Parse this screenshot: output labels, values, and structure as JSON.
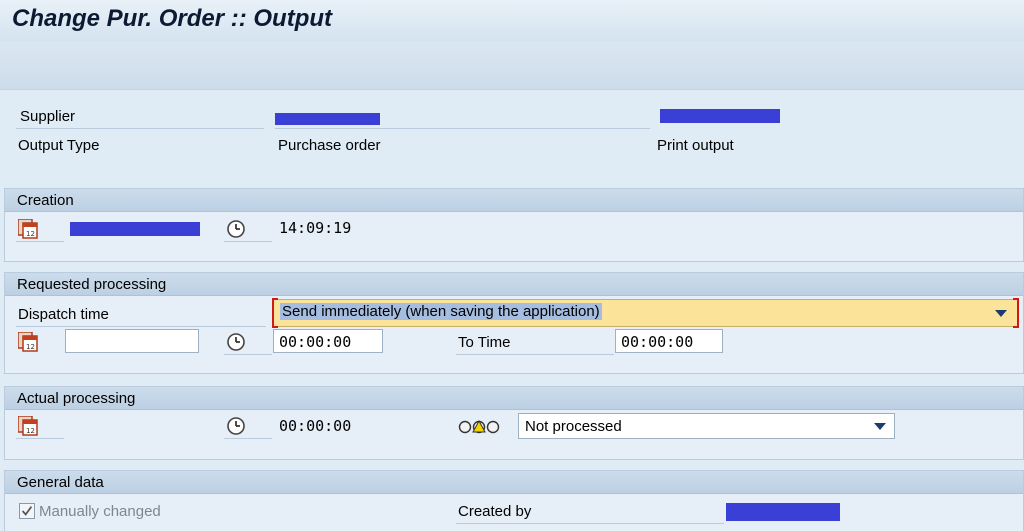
{
  "title": "Change Pur. Order :: Output",
  "header": {
    "supplier_label": "Supplier",
    "output_type_label": "Output Type",
    "output_type_value": "Purchase order",
    "medium_value": "Print output"
  },
  "creation": {
    "title": "Creation",
    "time": "14:09:19"
  },
  "requested": {
    "title": "Requested processing",
    "dispatch_label": "Dispatch time",
    "dispatch_value": "Send immediately (when saving the application)",
    "date_value": "",
    "time_value": "00:00:00",
    "to_time_label": "To Time",
    "to_time_value": "00:00:00"
  },
  "actual": {
    "title": "Actual processing",
    "time": "00:00:00",
    "status_value": "Not processed"
  },
  "general": {
    "title": "General data",
    "manually_changed_label": "Manually changed",
    "manually_changed_checked": true,
    "created_by_label": "Created by"
  },
  "icons": {
    "calendar": "calendar-icon",
    "clock": "clock-icon",
    "status": "traffic-light-yellow-icon",
    "dropdown": "chevron-down-icon"
  }
}
